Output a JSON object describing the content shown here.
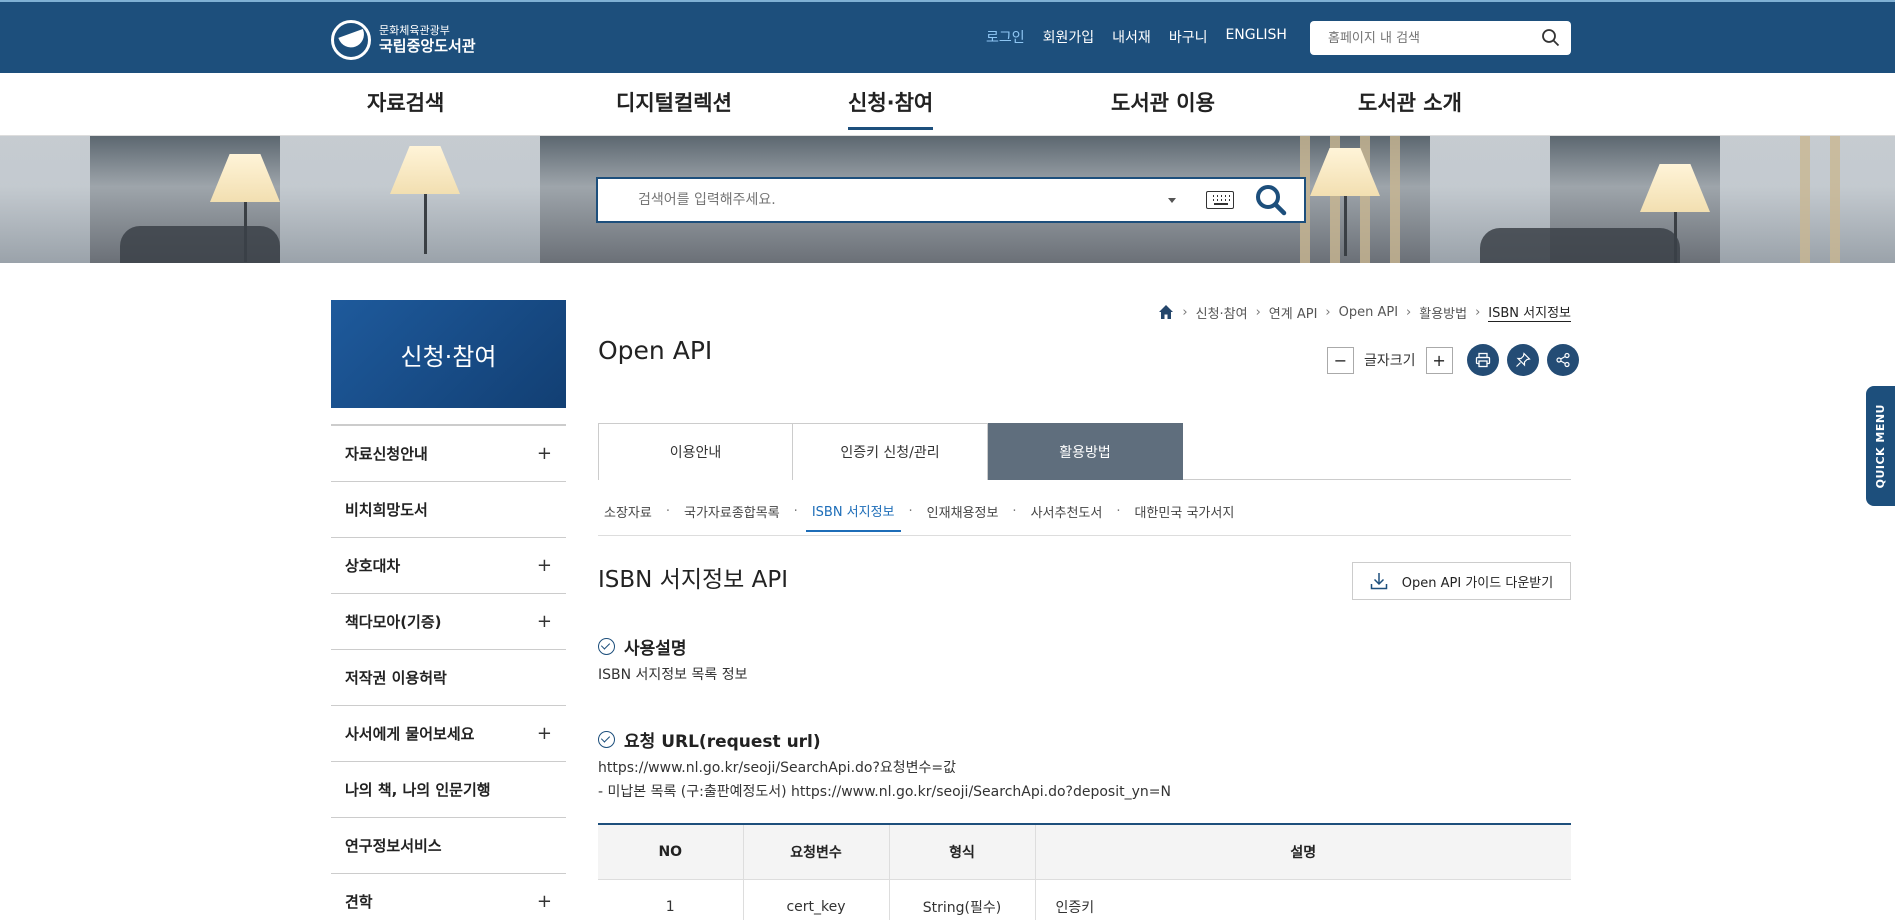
{
  "header": {
    "logo_sub": "문화체육관광부",
    "logo_main": "국립중앙도서관",
    "util_links": [
      "로그인",
      "회원가입",
      "내서재",
      "바구니",
      "ENGLISH"
    ],
    "search_placeholder": "홈페이지 내 검색"
  },
  "gnb": [
    "자료검색",
    "디지털컬렉션",
    "신청·참여",
    "도서관 이용",
    "도서관 소개"
  ],
  "hero": {
    "search_placeholder": "검색어를 입력해주세요."
  },
  "sidebar": {
    "title": "신청·참여",
    "items": [
      {
        "label": "자료신청안내",
        "expand": "+"
      },
      {
        "label": "비치희망도서",
        "expand": ""
      },
      {
        "label": "상호대차",
        "expand": "+"
      },
      {
        "label": "책다모아(기증)",
        "expand": "+"
      },
      {
        "label": "저작권 이용허락",
        "expand": ""
      },
      {
        "label": "사서에게 물어보세요",
        "expand": "+"
      },
      {
        "label": "나의 책, 나의 인문기행",
        "expand": ""
      },
      {
        "label": "연구정보서비스",
        "expand": ""
      },
      {
        "label": "견학",
        "expand": "+"
      }
    ]
  },
  "breadcrumb": [
    "신청·참여",
    "연계 API",
    "Open API",
    "활용방법",
    "ISBN 서지정보"
  ],
  "page_title": "Open API",
  "tools": {
    "font_size_label": "글자크기",
    "minus": "−",
    "plus": "+"
  },
  "tabs": [
    "이용안내",
    "인증키 신청/관리",
    "활용방법"
  ],
  "subtabs": [
    "소장자료",
    "국가자료종합목록",
    "ISBN 서지정보",
    "인재채용정보",
    "사서추천도서",
    "대한민국 국가서지"
  ],
  "section": {
    "title": "ISBN 서지정보 API",
    "download_label": "Open API 가이드 다운받기",
    "usage_heading": "사용설명",
    "usage_text": "ISBN 서지정보 목록 정보",
    "url_heading": "요청 URL(request url)",
    "url_line1": "https://www.nl.go.kr/seoji/SearchApi.do?요청변수=값",
    "url_line2": "- 미납본 목록 (구:출판예정도서) https://www.nl.go.kr/seoji/SearchApi.do?deposit_yn=N"
  },
  "table": {
    "headers": [
      "NO",
      "요청변수",
      "형식",
      "설명"
    ],
    "rows": [
      [
        "1",
        "cert_key",
        "String(필수)",
        "인증키"
      ]
    ]
  },
  "quick_menu": "QUICK MENU",
  "colors": {
    "primary": "#1d4f7c",
    "active_tab": "#5f6e7d",
    "link_active": "#1d6db8"
  }
}
